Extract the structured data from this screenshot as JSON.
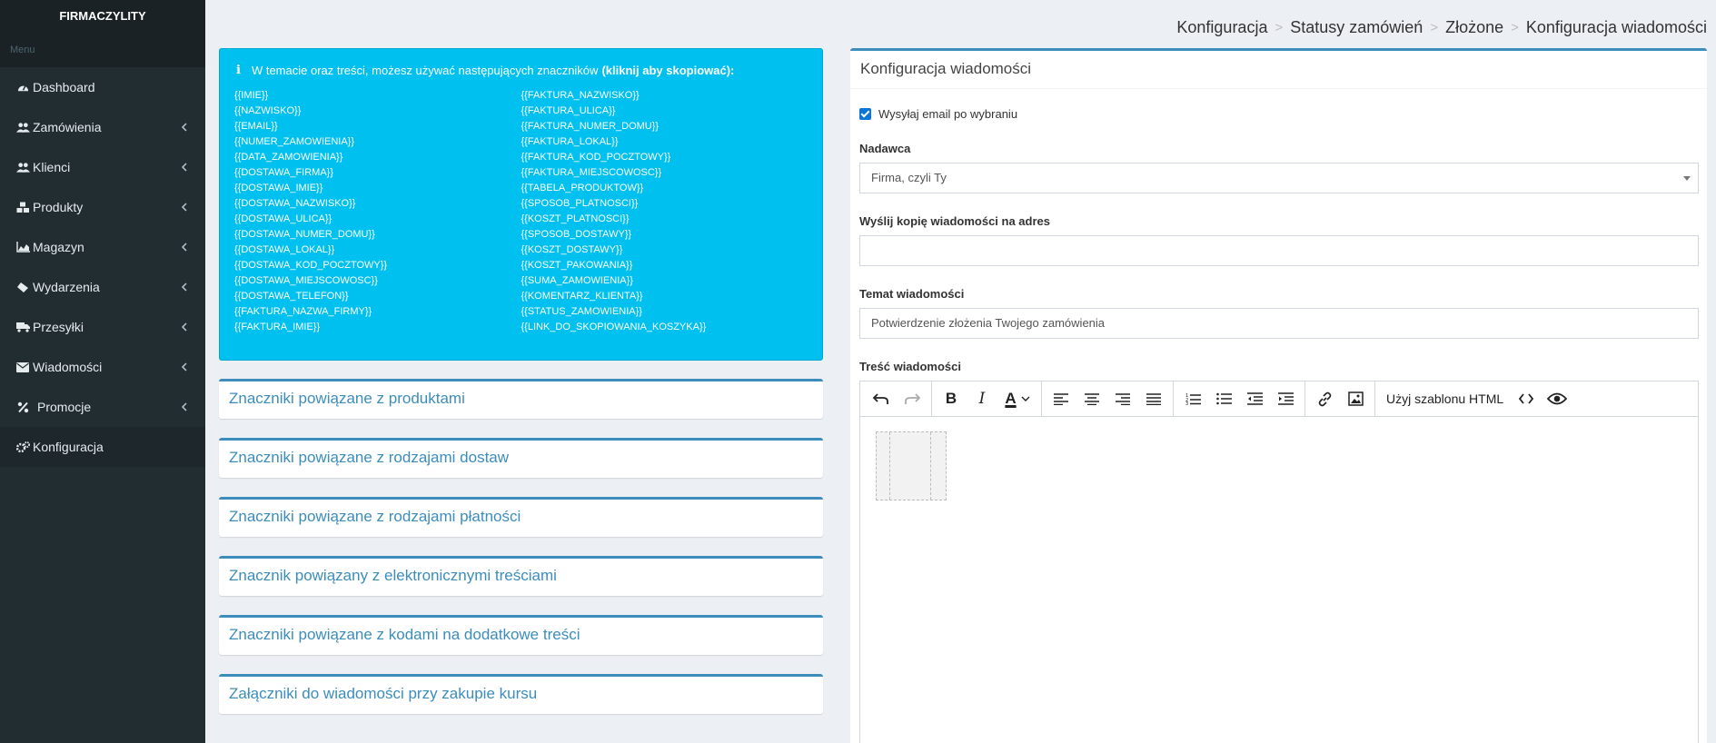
{
  "brand": "FIRMACZYLITY",
  "sidebar": {
    "menu_header": "Menu",
    "items": [
      {
        "label": "Dashboard",
        "icon": "dashboard-icon"
      },
      {
        "label": "Zamówienia",
        "icon": "users-icon"
      },
      {
        "label": "Klienci",
        "icon": "users-icon"
      },
      {
        "label": "Produkty",
        "icon": "cubes-icon"
      },
      {
        "label": "Magazyn",
        "icon": "area-chart-icon"
      },
      {
        "label": "Wydarzenia",
        "icon": "ticket-icon"
      },
      {
        "label": "Przesyłki",
        "icon": "truck-icon"
      },
      {
        "label": "Wiadomości",
        "icon": "envelope-icon"
      },
      {
        "label": "Promocje",
        "icon": "percent-icon"
      },
      {
        "label": "Konfiguracja",
        "icon": "cogs-icon"
      }
    ]
  },
  "breadcrumb": [
    "Konfiguracja",
    "Statusy zamówień",
    "Złożone",
    "Konfiguracja wiadomości"
  ],
  "breadcrumb_separator": ">",
  "info": {
    "title_prefix": "W temacie oraz treści, możesz używać następujących znaczników",
    "title_bold": "(kliknij aby skopiować):",
    "col1": [
      "{{IMIE}}",
      "{{NAZWISKO}}",
      "{{EMAIL}}",
      "{{NUMER_ZAMOWIENIA}}",
      "{{DATA_ZAMOWIENIA}}",
      "{{DOSTAWA_FIRMA}}",
      "{{DOSTAWA_IMIE}}",
      "{{DOSTAWA_NAZWISKO}}",
      "{{DOSTAWA_ULICA}}",
      "{{DOSTAWA_NUMER_DOMU}}",
      "{{DOSTAWA_LOKAL}}",
      "{{DOSTAWA_KOD_POCZTOWY}}",
      "{{DOSTAWA_MIEJSCOWOSC}}",
      "{{DOSTAWA_TELEFON}}",
      "{{FAKTURA_NAZWA_FIRMY}}",
      "{{FAKTURA_IMIE}}"
    ],
    "col2": [
      "{{FAKTURA_NAZWISKO}}",
      "{{FAKTURA_ULICA}}",
      "{{FAKTURA_NUMER_DOMU}}",
      "{{FAKTURA_LOKAL}}",
      "{{FAKTURA_KOD_POCZTOWY}}",
      "{{FAKTURA_MIEJSCOWOSC}}",
      "{{TABELA_PRODUKTOW}}",
      "{{SPOSOB_PLATNOSCI}}",
      "{{KOSZT_PLATNOSCI}}",
      "{{SPOSOB_DOSTAWY}}",
      "{{KOSZT_DOSTAWY}}",
      "{{KOSZT_PAKOWANIA}}",
      "{{SUMA_ZAMOWIENIA}}",
      "{{KOMENTARZ_KLIENTA}}",
      "{{STATUS_ZAMOWIENIA}}",
      "{{LINK_DO_SKOPIOWANIA_KOSZYKA}}"
    ]
  },
  "panels": [
    "Znaczniki powiązane z produktami",
    "Znaczniki powiązane z rodzajami dostaw",
    "Znaczniki powiązane z rodzajami płatności",
    "Znacznik powiązany z elektronicznymi treściami",
    "Znaczniki powiązane z kodami na dodatkowe treści",
    "Załączniki do wiadomości przy zakupie kursu"
  ],
  "config": {
    "title": "Konfiguracja wiadomości",
    "send_email_label": "Wysyłaj email po wybraniu",
    "send_email_checked": true,
    "sender_label": "Nadawca",
    "sender_value": "Firma, czyli Ty",
    "copy_label": "Wyślij kopię wiadomości na adres",
    "copy_value": "",
    "subject_label": "Temat wiadomości",
    "subject_value": "Potwierdzenie złożenia Twojego zamówienia",
    "body_label": "Treść wiadomości",
    "template_button": "Użyj szablonu HTML"
  },
  "colors": {
    "sidebar": "#222d32",
    "info": "#00c0ef",
    "accent": "#3c8dbc",
    "page": "#ecf0f5"
  }
}
